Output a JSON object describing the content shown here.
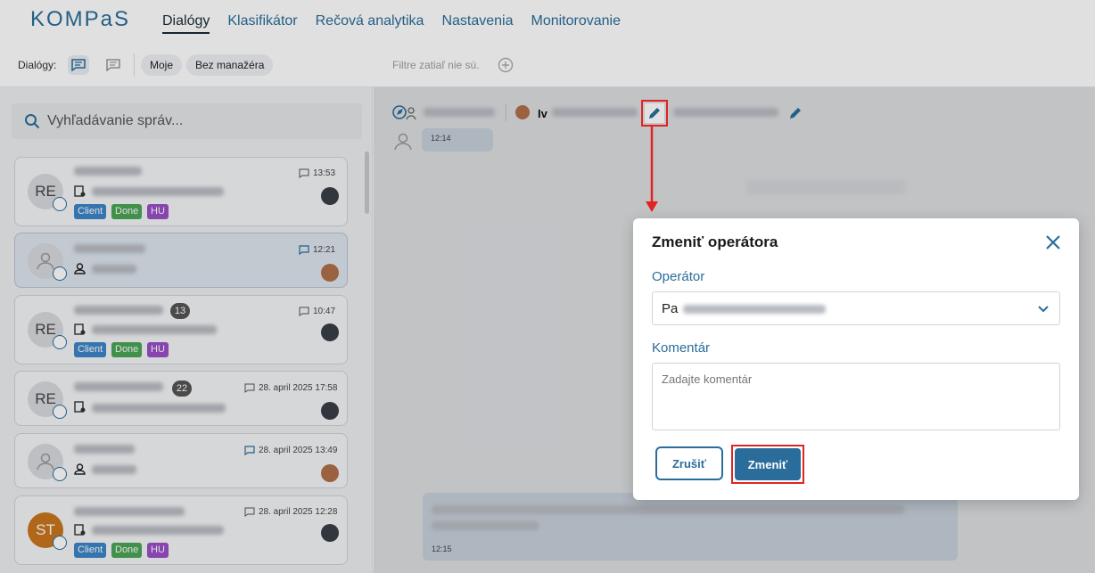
{
  "app": {
    "logo": "KOMPaS"
  },
  "nav": {
    "items": [
      "Dialógy",
      "Klasifikátor",
      "Rečová analytika",
      "Nastavenia",
      "Monitorovanie"
    ]
  },
  "subbar": {
    "label": "Dialógy:",
    "chip_mine": "Moje",
    "chip_no_manager": "Bez manažéra",
    "filter_text": "Filtre zatiaľ nie sú."
  },
  "search": {
    "placeholder": "Vyhľadávanie správ..."
  },
  "cards": [
    {
      "avatar": "RE",
      "time": "13:53",
      "badges": [
        "Client",
        "Done",
        "HU"
      ]
    },
    {
      "avatar": "",
      "time": "12:21"
    },
    {
      "avatar": "RE",
      "count": "13",
      "time": "10:47",
      "badges": [
        "Client",
        "Done",
        "HU"
      ]
    },
    {
      "avatar": "RE",
      "count": "22",
      "time": "28. april 2025 17:58"
    },
    {
      "avatar": "",
      "time": "28. april 2025 13:49"
    },
    {
      "avatar": "ST",
      "time": "28. april 2025 12:28",
      "badges": [
        "Client",
        "Done",
        "HU"
      ]
    }
  ],
  "chat": {
    "operator_prefix": "Iv",
    "msg_time_1": "12:14",
    "msg_time_2": "12:15"
  },
  "modal": {
    "title": "Zmeniť operátora",
    "operator_label": "Operátor",
    "operator_value": "Pa",
    "comment_label": "Komentár",
    "comment_placeholder": "Zadajte komentár",
    "cancel": "Zrušiť",
    "confirm": "Zmeniť"
  },
  "colors": {
    "accent": "#2a6d9a",
    "highlight": "#e32323"
  }
}
